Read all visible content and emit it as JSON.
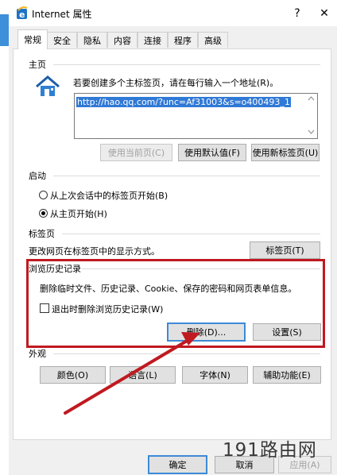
{
  "window": {
    "title": "Internet 属性",
    "help_label": "?",
    "close_label": "✕"
  },
  "tabs": [
    {
      "label": "常规",
      "active": true
    },
    {
      "label": "安全"
    },
    {
      "label": "隐私"
    },
    {
      "label": "内容"
    },
    {
      "label": "连接"
    },
    {
      "label": "程序"
    },
    {
      "label": "高级"
    }
  ],
  "home": {
    "group_label": "主页",
    "instruction": "若要创建多个主标签页，请在每行输入一个地址(R)。",
    "url_value": "http://hao.qq.com/?unc=Af31003&s=o400493_1",
    "btn_use_current": "使用当前页(C)",
    "btn_use_default": "使用默认值(F)",
    "btn_use_new_tab": "使用新标签页(U)"
  },
  "startup": {
    "group_label": "启动",
    "option_last_session": "从上次会话中的标签页开始(B)",
    "option_home": "从主页开始(H)",
    "selected": "option_home"
  },
  "tabs_group": {
    "group_label": "标签页",
    "description": "更改网页在标签页中的显示方式。",
    "btn_tabs": "标签页(T)"
  },
  "history": {
    "group_label": "浏览历史记录",
    "description": "删除临时文件、历史记录、Cookie、保存的密码和网页表单信息。",
    "checkbox_label": "退出时删除浏览历史记录(W)",
    "checkbox_checked": false,
    "btn_delete": "删除(D)...",
    "btn_settings": "设置(S)"
  },
  "appearance": {
    "group_label": "外观",
    "btn_colors": "颜色(O)",
    "btn_languages": "语言(L)",
    "btn_fonts": "字体(N)",
    "btn_accessibility": "辅助功能(E)"
  },
  "footer": {
    "btn_ok": "确定",
    "btn_cancel": "取消",
    "btn_apply": "应用(A)"
  },
  "watermark": "191路由网",
  "colors": {
    "highlight_box": "#c01920",
    "selection": "#3079d6",
    "default_button_border": "#3d8ad7"
  }
}
